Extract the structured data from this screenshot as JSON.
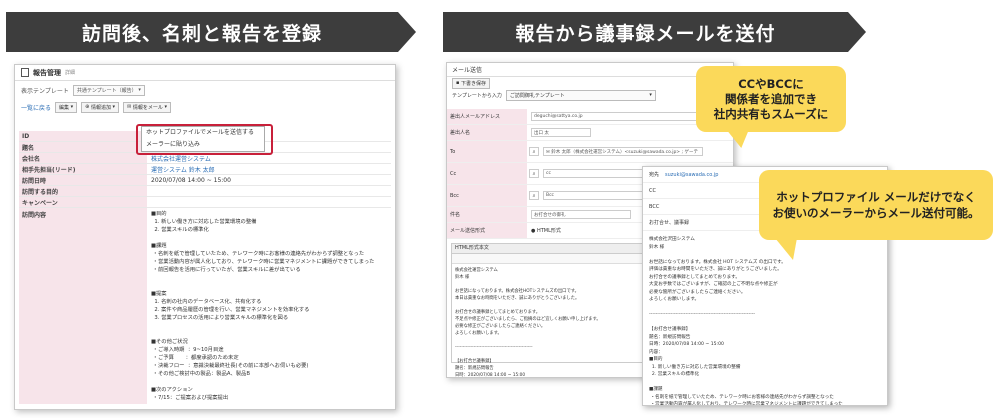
{
  "banners": {
    "left": "訪問後、名刺と報告を登録",
    "right": "報告から議事録メールを送付"
  },
  "left_screen": {
    "title": "報告管理",
    "subtitle": "詳細",
    "template_label": "表示テンプレート",
    "template_value": "共通テンプレート（報告）",
    "back_link": "一覧に戻る",
    "buttons": {
      "edit": "編集",
      "add_info": "情報追加",
      "send_mail": "情報をメール"
    },
    "menu": [
      "ホットプロファイルでメールを送信する",
      "メーラーに貼り込み"
    ],
    "fields": [
      {
        "label": "ID",
        "value": "",
        "link": false
      },
      {
        "label": "題名",
        "value": "",
        "link": false
      },
      {
        "label": "会社名",
        "value": "株式会社運営システム",
        "link": true
      },
      {
        "label": "相手先担当(リード)",
        "value": "運営システム 鈴木 太郎",
        "link": true
      },
      {
        "label": "訪問日時",
        "value": "2020/07/08 14:00 ~ 15:00",
        "link": false
      },
      {
        "label": "訪問する目的",
        "value": "",
        "link": false
      },
      {
        "label": "キャンペーン",
        "value": "",
        "link": false
      }
    ],
    "content_label": "訪問内容",
    "content_text": "■目的\n  1. 新しい働き方に対応した営業環境の整備\n  2. 営業スキルの標準化\n\n■課題\n ・名刺を紙で管理していたため、テレワーク時にお客様の連絡先がわからず調整となった\n ・営業活動内容が属人化しており、テレワーク時に営業マネジメントに課題ができてしまった\n ・前回報告を活用に行っていたが、営業スキルに差が出ている\n\n\n■提案\n  1. 名刺の社内のデータベース化、共有化する\n  2. 案件や商品履歴の管理を行い、営業マネジメントを効率化する\n  3. 営業プロセスの活用により営業スキルの標準化を図る\n\n\n■その他ご状況\n ・ご導入時期  ：9~10月目途\n ・ご予算       ：都度承認のため未定\n ・決裁フロー  ：意識決裁最終社長(その前に本部へお伺いも必要)\n ・その他ご検討中の製品：製品A、製品B\n\n■次のアクション\n ・7/15：ご提案および提案提出"
  },
  "mail_window": {
    "title": "メール送信",
    "select_button": "下書き保存",
    "template_label": "テンプレートから入力",
    "template_value": "ご訪問御礼テンプレート",
    "fields": [
      {
        "label": "差出人メールアドレス",
        "value": "deguchi@sattya.co.jp",
        "search": false
      },
      {
        "label": "差出人名",
        "value": "出口 太",
        "search": false
      },
      {
        "label": "To",
        "value": "✉ 鈴木 太郎（株式会社運営システム）<suzuki@sawada.co.jp> ; ゲーテ",
        "search": true
      },
      {
        "label": "Cc",
        "value": "cc",
        "search": true
      },
      {
        "label": "Bcc",
        "value": "Bcc",
        "search": true
      },
      {
        "label": "件名",
        "value": "お打合せの御礼",
        "search": false
      },
      {
        "label": "メール送信形式",
        "value": "● HTML形式",
        "search": false
      }
    ],
    "editor_tab": "HTML形式本文",
    "body": "株式会社運営システム\n鈴木 様\n\nお世話になっております。株式会社HOTシステムズの出口です。\n本日は貴重なお時間をいただき、誠にありがとうございました。\n\nお打合せの議事録としてまとめております。\n不足点や修正がございましたら、ご指摘のほど宜しくお願い申し上げます。\n必要な修正がございましたらご連絡ください。\nよろしくお願いします。\n\n--------------------------------------------------\n\n【お打合せ議事録】\n題名：新規訪問報告\n日時：2020/07/08 14:00 ~ 15:00"
  },
  "preview_window": {
    "to_label": "宛先",
    "to_value": "suzuki@sawada.co.jp",
    "cc": "CC",
    "bcc": "BCC",
    "subject": "お打合せ、議事録",
    "body": "株式会社沢田システム\n鈴木 様\n\nお世話になっております。株式会社 HOT システムズ の出口です。\n評価は貴重なお時間をいただき、誠にありがとうございました。\nお打合せの議事録としてまとめております。\n大変お手数ではございますが、ご確認の上ご不明な点や修正が\n必要な箇所がございましたらご連絡ください。\nよろしくお願いします。\n\n----------------------------------------------------------------\n\n【お打合せ議事録】\n題名：新規訪問報告\n日時：2020/07/08 14:00 ~ 15:00\n内容：\n■目的\n  1. 新しい働き方に対応した営業環境の整備\n  2. 営業スキルの標準化\n\n■課題\n ・名刺を紙で管理していたため、テレワーク時にお客様の連絡先がわからず調整となった\n ・営業活動内容が属人化しており、テレワーク時に営業マネジメントに課題ができてしまった\n ・前回報告を活用に行っていたが、営業スキルに差が出ている"
  },
  "callouts": {
    "first": "CCやBCCに\n関係者を追加でき\n社内共有もスムーズに",
    "second": "ホットプロファイル メールだけでなく\nお使いのメーラーからメール送付可能。"
  },
  "colors": {
    "banner": "#3d3d3d",
    "highlight": "#c8203a",
    "callout": "#fbd95a",
    "label_bg": "#f7e4ea",
    "link": "#2a6db5"
  }
}
